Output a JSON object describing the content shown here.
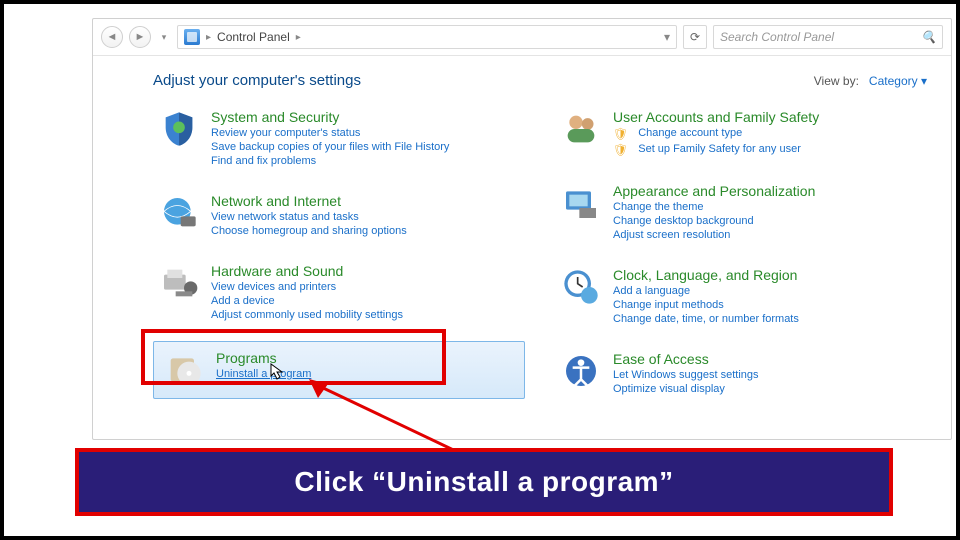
{
  "breadcrumb": {
    "label": "Control Panel"
  },
  "search": {
    "placeholder": "Search Control Panel"
  },
  "header": {
    "title": "Adjust your computer's settings"
  },
  "viewby": {
    "label": "View by:",
    "value": "Category"
  },
  "left": [
    {
      "title": "System and Security",
      "links": [
        "Review your computer's status",
        "Save backup copies of your files with File History",
        "Find and fix problems"
      ]
    },
    {
      "title": "Network and Internet",
      "links": [
        "View network status and tasks",
        "Choose homegroup and sharing options"
      ]
    },
    {
      "title": "Hardware and Sound",
      "links": [
        "View devices and printers",
        "Add a device",
        "Adjust commonly used mobility settings"
      ]
    },
    {
      "title": "Programs",
      "links": [
        "Uninstall a program"
      ]
    }
  ],
  "right": [
    {
      "title": "User Accounts and Family Safety",
      "links": [
        "Change account type",
        "Set up Family Safety for any user"
      ]
    },
    {
      "title": "Appearance and Personalization",
      "links": [
        "Change the theme",
        "Change desktop background",
        "Adjust screen resolution"
      ]
    },
    {
      "title": "Clock, Language, and Region",
      "links": [
        "Add a language",
        "Change input methods",
        "Change date, time, or number formats"
      ]
    },
    {
      "title": "Ease of Access",
      "links": [
        "Let Windows suggest settings",
        "Optimize visual display"
      ]
    }
  ],
  "caption": "Click “Uninstall a program”"
}
